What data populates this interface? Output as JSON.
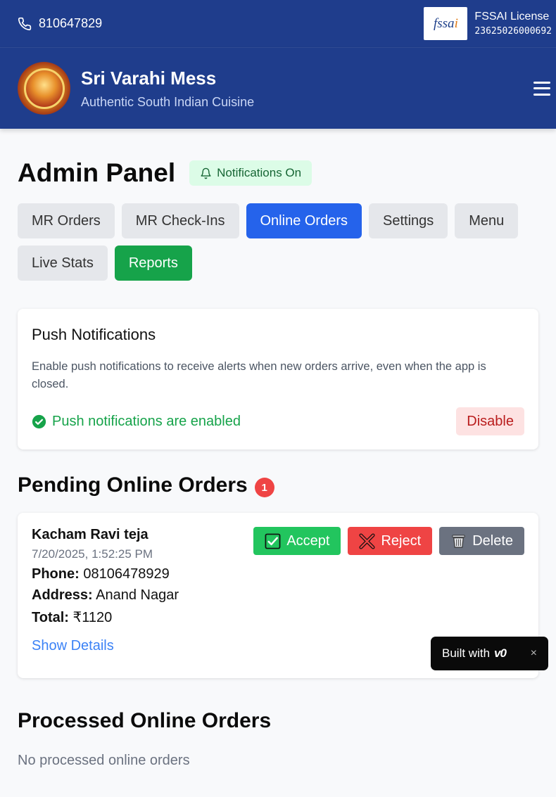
{
  "topbar": {
    "phone": "810647829",
    "fssai_logo_text": "fssai",
    "fssai_label": "FSSAI License",
    "fssai_number": "23625026000692"
  },
  "header": {
    "brand_name": "Sri Varahi Mess",
    "tagline": "Authentic South Indian Cuisine",
    "logo_text": "Sri Varahi Mess"
  },
  "admin": {
    "title": "Admin Panel",
    "notifications_badge": "Notifications On",
    "tabs": [
      {
        "label": "MR Orders",
        "state": "default"
      },
      {
        "label": "MR Check-Ins",
        "state": "default"
      },
      {
        "label": "Online Orders",
        "state": "active"
      },
      {
        "label": "Settings",
        "state": "default"
      },
      {
        "label": "Menu",
        "state": "default"
      },
      {
        "label": "Live Stats",
        "state": "default"
      },
      {
        "label": "Reports",
        "state": "green"
      }
    ]
  },
  "push": {
    "title": "Push Notifications",
    "description": "Enable push notifications to receive alerts when new orders arrive, even when the app is closed.",
    "status": "Push notifications are enabled",
    "disable_label": "Disable"
  },
  "pending": {
    "title": "Pending Online Orders",
    "count": "1",
    "orders": [
      {
        "name": "Kacham Ravi teja",
        "timestamp": "7/20/2025, 1:52:25 PM",
        "phone_label": "Phone:",
        "phone": "08106478929",
        "address_label": "Address:",
        "address": "Anand Nagar",
        "total_label": "Total:",
        "total": "₹1120",
        "show_details": "Show Details",
        "accept_label": "Accept",
        "reject_label": "Reject",
        "delete_label": "Delete"
      }
    ]
  },
  "processed": {
    "title": "Processed Online Orders",
    "empty": "No processed online orders"
  },
  "v0_badge": {
    "label": "Built with",
    "logo": "v0",
    "close": "×"
  },
  "colors": {
    "header_bg": "#1f3d8c",
    "active_tab": "#2563eb",
    "reports_tab": "#16a34a",
    "accept": "#22c55e",
    "reject": "#ef4444",
    "delete": "#6b7280",
    "link": "#3b82f6"
  },
  "icons": {
    "phone": "phone-icon",
    "bell": "bell-icon",
    "check_circle": "check-circle-icon",
    "accept": "checkbox-check-icon",
    "reject": "cross-x-icon",
    "delete": "trash-icon",
    "menu": "hamburger-menu-icon"
  }
}
